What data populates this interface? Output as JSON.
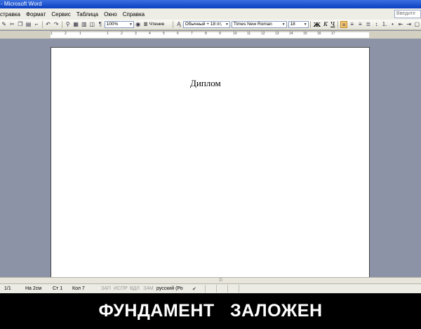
{
  "window": {
    "title": "- Microsoft Word"
  },
  "menu": {
    "items": [
      "стравка",
      "Формат",
      "Сервис",
      "Таблица",
      "Окно",
      "Справка"
    ],
    "search_placeholder": "Введите"
  },
  "toolbar": {
    "zoom": "100%",
    "reading_label": "Чтение",
    "style": "Обычный + 18 пт,",
    "font": "Times New Roman",
    "size": "18",
    "bold": "Ж",
    "italic": "К",
    "underline": "Ч"
  },
  "ruler": {
    "ticks": [
      "1",
      "2",
      "1",
      "1",
      "2",
      "3",
      "4",
      "5",
      "6",
      "7",
      "8",
      "9",
      "10",
      "11",
      "12",
      "13",
      "14",
      "15",
      "16",
      "17"
    ]
  },
  "document": {
    "title": "Диплом"
  },
  "status": {
    "page": "1/1",
    "at": "На 2см",
    "line": "Ст 1",
    "col": "Кол 7",
    "rec": "ЗАП",
    "trk": "ИСПР",
    "ext": "ВДЛ",
    "ovr": "ЗАМ",
    "lang": "русский (Ро"
  },
  "caption": "ФУНДАМЕНТ   ЗАЛОЖЕН"
}
